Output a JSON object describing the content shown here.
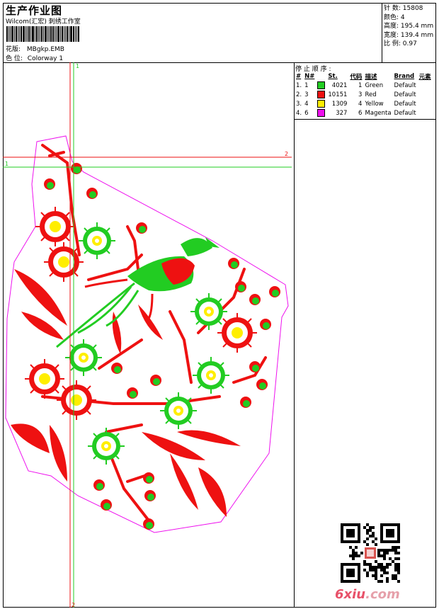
{
  "header": {
    "title": "生产作业图",
    "subtitle": "Wilcom(汇宏) 刺绣工作室",
    "design_label": "花版:",
    "design_value": "MBgkp.EMB",
    "colorway_label": "色 位:",
    "colorway_value": "Colorway 1"
  },
  "stats": [
    {
      "label": "针 数:",
      "value": "15808"
    },
    {
      "label": "颜色:",
      "value": "4"
    },
    {
      "label": "高度:",
      "value": "195.4 mm"
    },
    {
      "label": "宽度:",
      "value": "139.4 mm"
    },
    {
      "label": "比 例:",
      "value": "0.97"
    }
  ],
  "stop_sequence": {
    "title": "停 止 顺 序 :",
    "headers": [
      "#",
      "N#",
      "St.",
      "代码",
      "描述",
      "Brand",
      "元素"
    ],
    "rows": [
      {
        "idx": "1.",
        "n": "1",
        "color": "#22cc22",
        "stitches": "4021",
        "code": "1",
        "desc": "Green",
        "brand": "Default"
      },
      {
        "idx": "2.",
        "n": "3",
        "color": "#ee1111",
        "stitches": "10151",
        "code": "3",
        "desc": "Red",
        "brand": "Default"
      },
      {
        "idx": "3.",
        "n": "4",
        "color": "#ffee00",
        "stitches": "1309",
        "code": "4",
        "desc": "Yellow",
        "brand": "Default"
      },
      {
        "idx": "4.",
        "n": "6",
        "color": "#ee11ee",
        "stitches": "327",
        "code": "6",
        "desc": "Magenta",
        "brand": "Default"
      }
    ]
  },
  "guides": {
    "v_top": "1",
    "v_bottom": "2",
    "h_left": "1",
    "h_right": "2"
  },
  "colors": {
    "green": "#22cc22",
    "red": "#ee1111",
    "yellow": "#ffee00",
    "magenta": "#ee11ee"
  },
  "watermark": {
    "brand": "6xiu",
    "domain": ".com"
  }
}
